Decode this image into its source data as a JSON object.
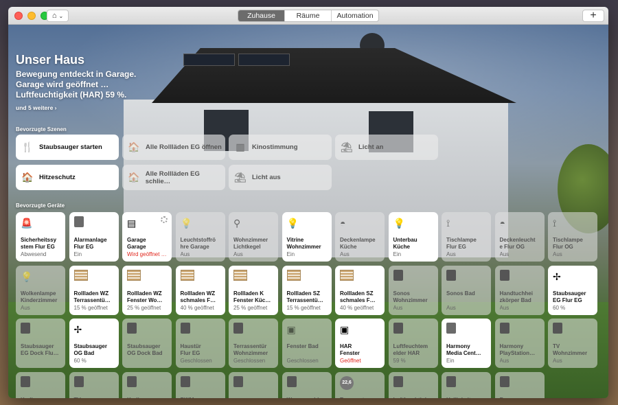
{
  "segments": [
    "Zuhause",
    "Räume",
    "Automation"
  ],
  "home_title": "Unser Haus",
  "status_lines": [
    "Bewegung entdeckt in Garage.",
    "Garage wird geöffnet …",
    "Luftfeuchtigkeit (HAR) 59 %."
  ],
  "more_link": "und 5 weitere ›",
  "scenes_label": "Bevorzugte Szenen",
  "devices_label": "Bevorzugte Geräte",
  "scenes": [
    {
      "label": "Staubsauger starten",
      "icon": "fork-knife-icon",
      "on": true
    },
    {
      "label": "Alle Rollläden EG öffnen",
      "icon": "house-sun-icon",
      "on": false
    },
    {
      "label": "Kinostimmung",
      "icon": "fireplace-icon",
      "on": false
    },
    {
      "label": "Licht an",
      "icon": "lounge-chair-icon",
      "on": false
    },
    {
      "label": "Hitzeschutz",
      "icon": "house-sun-icon",
      "on": true
    },
    {
      "label": "Alle Rollläden EG schlie…",
      "icon": "house-moon-icon",
      "on": false
    },
    {
      "label": "Licht aus",
      "icon": "lounge-chair-icon",
      "on": false
    }
  ],
  "devices": [
    {
      "n1": "Sicherheitssy",
      "n2": "stem Flur EG",
      "s": "Abwesend",
      "on": true,
      "icon": "siren-icon",
      "alert": false
    },
    {
      "n1": "Alarmanlage",
      "n2": "Flur EG",
      "s": "Ein",
      "on": true,
      "icon": "switch-icon",
      "alert": false
    },
    {
      "n1": "Garage",
      "n2": "Garage",
      "s": "Wird geöffnet …",
      "on": true,
      "icon": "garage-icon",
      "alert": true
    },
    {
      "n1": "Leuchtstoffrö",
      "n2": "hre Garage",
      "s": "Aus",
      "on": false,
      "icon": "bulb-icon",
      "alert": false
    },
    {
      "n1": "Wohnzimmer",
      "n2": "Lichtkegel",
      "s": "Aus",
      "on": false,
      "icon": "desk-lamp-icon",
      "alert": false
    },
    {
      "n1": "Vitrine",
      "n2": "Wohnzimmer",
      "s": "Ein",
      "on": true,
      "icon": "bulb-icon",
      "alert": false
    },
    {
      "n1": "Deckenlampe",
      "n2": "Küche",
      "s": "Aus",
      "on": false,
      "icon": "ceiling-lamp-icon",
      "alert": false
    },
    {
      "n1": "Unterbau",
      "n2": "Küche",
      "s": "Ein",
      "on": true,
      "icon": "bulb-icon",
      "alert": false
    },
    {
      "n1": "Tischlampe",
      "n2": "Flur EG",
      "s": "Aus",
      "on": false,
      "icon": "floor-lamp-icon",
      "alert": false
    },
    {
      "n1": "Deckenleucht",
      "n2": "e Flur OG",
      "s": "Aus",
      "on": false,
      "icon": "ceiling-lamp-icon",
      "alert": false
    },
    {
      "n1": "Tischlampe",
      "n2": "Flur OG",
      "s": "Aus",
      "on": false,
      "icon": "floor-lamp-icon",
      "alert": false
    },
    {
      "n1": "Wolkenlampe",
      "n2": "Kinderzimmer",
      "s": "Aus",
      "on": false,
      "icon": "bulb-icon",
      "alert": false
    },
    {
      "n1": "Rollladen WZ",
      "n2": "Terrassentü…",
      "s": "15 % geöffnet",
      "on": true,
      "icon": "blinds-icon",
      "alert": false
    },
    {
      "n1": "Rollladen WZ",
      "n2": "Fenster Wo…",
      "s": "25 % geöffnet",
      "on": true,
      "icon": "blinds-icon",
      "alert": false
    },
    {
      "n1": "Rollladen WZ",
      "n2": "schmales F…",
      "s": "40 % geöffnet",
      "on": true,
      "icon": "blinds-icon",
      "alert": false
    },
    {
      "n1": "Rollladen K",
      "n2": "Fenster Küc…",
      "s": "25 % geöffnet",
      "on": true,
      "icon": "blinds-icon",
      "alert": false
    },
    {
      "n1": "Rollladen SZ",
      "n2": "Terrassentü…",
      "s": "15 % geöffnet",
      "on": true,
      "icon": "blinds-icon",
      "alert": false
    },
    {
      "n1": "Rollladen SZ",
      "n2": "schmales F…",
      "s": "40 % geöffnet",
      "on": true,
      "icon": "blinds-icon",
      "alert": false
    },
    {
      "n1": "Sonos",
      "n2": "Wohnzimmer",
      "s": "Aus",
      "on": false,
      "icon": "speaker-icon",
      "alert": false
    },
    {
      "n1": "Sonos Bad",
      "n2": "",
      "s": "Aus",
      "on": false,
      "icon": "speaker-icon",
      "alert": false
    },
    {
      "n1": "Handtuchhei",
      "n2": "zkörper Bad",
      "s": "Aus",
      "on": false,
      "icon": "heater-icon",
      "alert": false
    },
    {
      "n1": "Staubsauger",
      "n2": "EG Flur EG",
      "s": "60 %",
      "on": true,
      "icon": "fan-icon",
      "alert": false
    },
    {
      "n1": "Staubsauger",
      "n2": "EG Dock Flu…",
      "s": "",
      "on": false,
      "icon": "plug-icon",
      "alert": false
    },
    {
      "n1": "Staubsauger",
      "n2": "OG Bad",
      "s": "60 %",
      "on": true,
      "icon": "fan-icon",
      "alert": false
    },
    {
      "n1": "Staubsauger",
      "n2": "OG Dock Bad",
      "s": "",
      "on": false,
      "icon": "plug-icon",
      "alert": false
    },
    {
      "n1": "Haustür",
      "n2": "Flur EG",
      "s": "Geschlossen",
      "on": false,
      "icon": "door-icon",
      "alert": false
    },
    {
      "n1": "Terrassentür",
      "n2": "Wohnzimmer",
      "s": "Geschlossen",
      "on": false,
      "icon": "door-icon",
      "alert": false
    },
    {
      "n1": "Fenster Bad",
      "n2": "",
      "s": "Geschlossen",
      "on": false,
      "icon": "window-icon",
      "alert": false
    },
    {
      "n1": "HAR",
      "n2": "Fenster",
      "s": "Geöffnet",
      "on": true,
      "icon": "window-icon",
      "alert": true
    },
    {
      "n1": "Luftfeuchtem",
      "n2": "elder HAR",
      "s": "59 %",
      "on": false,
      "icon": "sensor-icon",
      "alert": false
    },
    {
      "n1": "Harmony",
      "n2": "Media Cent…",
      "s": "Ein",
      "on": true,
      "icon": "switch-icon",
      "alert": false
    },
    {
      "n1": "Harmony",
      "n2": "PlayStation…",
      "s": "Aus",
      "on": false,
      "icon": "switch-icon",
      "alert": false
    },
    {
      "n1": "TV",
      "n2": "Wohnzimmer",
      "s": "Aus",
      "on": false,
      "icon": "switch-icon",
      "alert": false
    },
    {
      "n1": "Kodi",
      "n2": "",
      "s": "",
      "on": false,
      "icon": "switch-icon",
      "alert": false
    },
    {
      "n1": "TV",
      "n2": "",
      "s": "",
      "on": false,
      "icon": "switch-icon",
      "alert": false
    },
    {
      "n1": "Kodi",
      "n2": "",
      "s": "",
      "on": false,
      "icon": "switch-icon",
      "alert": false
    },
    {
      "n1": "BWM",
      "n2": "",
      "s": "",
      "on": false,
      "icon": "sensor-icon",
      "alert": false
    },
    {
      "n1": "",
      "n2": "",
      "s": "",
      "on": false,
      "icon": "sensor-icon",
      "alert": false
    },
    {
      "n1": "Wassermelde",
      "n2": "",
      "s": "",
      "on": false,
      "icon": "sensor-icon",
      "alert": false
    },
    {
      "n1": "Temperatur",
      "n2": "",
      "s": "",
      "on": false,
      "icon": "thermometer-icon",
      "alert": false,
      "badge": "22,6"
    },
    {
      "n1": "Luftfeuchtigk",
      "n2": "",
      "s": "",
      "on": false,
      "icon": "sensor-icon",
      "alert": false
    },
    {
      "n1": "Helligkeit",
      "n2": "",
      "s": "",
      "on": false,
      "icon": "sensor-icon",
      "alert": false
    },
    {
      "n1": "Regensensor",
      "n2": "",
      "s": "",
      "on": false,
      "icon": "sensor-icon",
      "alert": false
    }
  ]
}
